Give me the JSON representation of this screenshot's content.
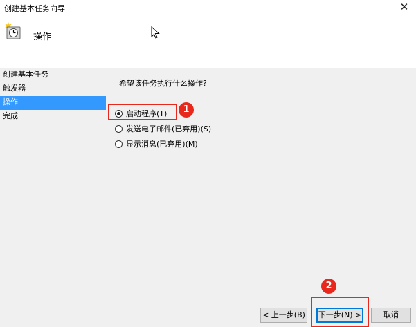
{
  "window": {
    "title": "创建基本任务向导",
    "close_glyph": "✕"
  },
  "header": {
    "title": "操作"
  },
  "nav": {
    "items": [
      {
        "label": "创建基本任务",
        "active": false
      },
      {
        "label": "触发器",
        "active": false
      },
      {
        "label": "操作",
        "active": true
      },
      {
        "label": "完成",
        "active": false
      }
    ]
  },
  "content": {
    "prompt": "希望该任务执行什么操作?",
    "options": [
      {
        "label": "启动程序(T)",
        "checked": true
      },
      {
        "label": "发送电子邮件(已弃用)(S)",
        "checked": false
      },
      {
        "label": "显示消息(已弃用)(M)",
        "checked": false
      }
    ]
  },
  "annotations": {
    "step1": "1",
    "step2": "2",
    "color": "#e8281c"
  },
  "buttons": {
    "back": "< 上一步(B)",
    "next": "下一步(N) >",
    "cancel": "取消"
  },
  "icons": {
    "header": "scheduled-task-clock-icon",
    "cursor": "mouse-pointer-icon"
  }
}
